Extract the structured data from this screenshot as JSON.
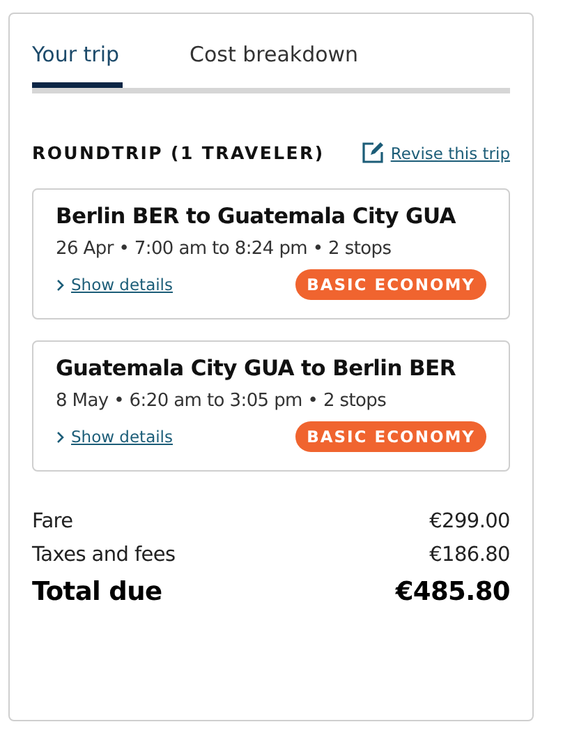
{
  "tabs": [
    {
      "label": "Your trip",
      "selected": true
    },
    {
      "label": "Cost breakdown",
      "selected": false
    }
  ],
  "heading": "ROUNDTRIP (1 TRAVELER)",
  "revise_link": "Revise this trip",
  "flights": [
    {
      "route": "Berlin BER to Guatemala City GUA",
      "info": "26 Apr • 7:00 am to 8:24 pm • 2 stops",
      "details_link": "Show details",
      "fare_class": "BASIC ECONOMY"
    },
    {
      "route": "Guatemala City GUA to Berlin BER",
      "info": "8 May • 6:20 am to 3:05 pm • 2 stops",
      "details_link": "Show details",
      "fare_class": "BASIC ECONOMY"
    }
  ],
  "costs": [
    {
      "kind": "line",
      "label": "Fare",
      "amount": "€299.00"
    },
    {
      "kind": "line",
      "label": "Taxes and fees",
      "amount": "€186.80"
    },
    {
      "kind": "total",
      "label": "Total due",
      "amount": "€485.80"
    }
  ]
}
